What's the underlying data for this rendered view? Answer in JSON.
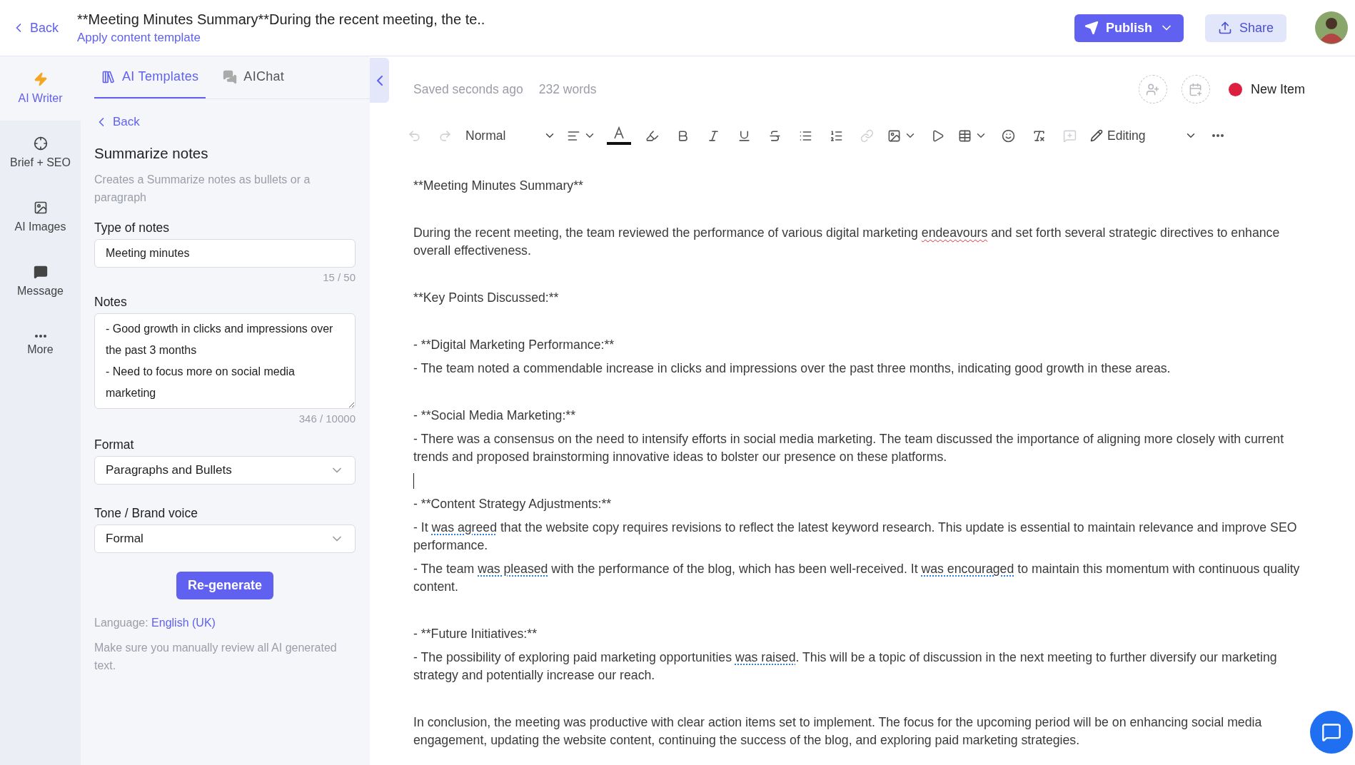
{
  "header": {
    "back": "Back",
    "title": "**Meeting Minutes Summary**During the recent meeting, the te..",
    "template_link": "Apply content template",
    "publish": "Publish",
    "share": "Share"
  },
  "rail": [
    {
      "label": "AI Writer",
      "selected": true
    },
    {
      "label": "Brief + SEO",
      "selected": false
    },
    {
      "label": "AI Images",
      "selected": false
    },
    {
      "label": "Message",
      "selected": false
    },
    {
      "label": "More",
      "selected": false
    }
  ],
  "panel": {
    "tabs": [
      {
        "label": "AI Templates",
        "selected": true
      },
      {
        "label": "AIChat",
        "selected": false
      }
    ],
    "back": "Back",
    "title": "Summarize notes",
    "description": "Creates a Summarize notes as bullets or a paragraph",
    "fields": [
      {
        "kind": "input",
        "label": "Type of notes",
        "value": "Meeting minutes",
        "count": "15 / 50"
      },
      {
        "kind": "textarea",
        "label": "Notes",
        "value": "- Good growth in clicks and impressions over the past 3 months\n- Need to focus more on social media marketing",
        "count": "346 / 10000"
      },
      {
        "kind": "select",
        "label": "Format",
        "value": "Paragraphs and Bullets"
      },
      {
        "kind": "select",
        "label": "Tone / Brand voice",
        "value": "Formal"
      }
    ],
    "button": "Re-generate",
    "language_label": "Language:",
    "language": "English (UK)",
    "disclaimer": "Make sure you manually review all AI generated text."
  },
  "editor": {
    "saved": "Saved seconds ago",
    "words": "232 words",
    "status": {
      "label": "New Item",
      "color": "#dc1f3f"
    },
    "toolbar": [
      {
        "kind": "undo",
        "disabled": true,
        "menu": false
      },
      {
        "kind": "redo",
        "disabled": true,
        "menu": false
      },
      {
        "kind": "select",
        "value": "Normal",
        "disabled": false,
        "menu": true
      },
      {
        "kind": "align",
        "disabled": false,
        "menu": true
      },
      {
        "kind": "text-color",
        "disabled": false,
        "menu": false
      },
      {
        "kind": "highlight",
        "disabled": false,
        "menu": false
      },
      {
        "kind": "bold",
        "disabled": false,
        "menu": false
      },
      {
        "kind": "italic",
        "disabled": false,
        "menu": false
      },
      {
        "kind": "underline",
        "disabled": false,
        "menu": false
      },
      {
        "kind": "strike",
        "disabled": false,
        "menu": false
      },
      {
        "kind": "bullets",
        "disabled": false,
        "menu": false
      },
      {
        "kind": "numbers",
        "disabled": false,
        "menu": false
      },
      {
        "kind": "link",
        "disabled": true,
        "menu": false
      },
      {
        "kind": "image",
        "disabled": false,
        "menu": true
      },
      {
        "kind": "video",
        "disabled": false,
        "menu": false
      },
      {
        "kind": "table",
        "disabled": false,
        "menu": true
      },
      {
        "kind": "emoji",
        "disabled": false,
        "menu": false
      },
      {
        "kind": "clear",
        "disabled": false,
        "menu": false
      },
      {
        "kind": "comment",
        "disabled": true,
        "menu": false
      },
      {
        "kind": "mode",
        "value": "Editing",
        "disabled": false,
        "menu": true
      },
      {
        "kind": "more",
        "disabled": false,
        "menu": false
      }
    ],
    "blocks": [
      {
        "kind": "paragraph",
        "text": "**Meeting Minutes Summary**"
      },
      {
        "kind": "blank"
      },
      {
        "kind": "paragraph",
        "segments": [
          {
            "text": "During the recent meeting, the team reviewed the performance of various digital marketing "
          },
          {
            "text": "endeavours",
            "kind": "spelling"
          },
          {
            "text": " and set forth several strategic directives to enhance overall effectiveness."
          }
        ]
      },
      {
        "kind": "blank"
      },
      {
        "kind": "paragraph",
        "text": "**Key Points Discussed:**"
      },
      {
        "kind": "blank"
      },
      {
        "kind": "paragraph",
        "text": "- **Digital Marketing Performance:**"
      },
      {
        "kind": "paragraph",
        "text": "- The team noted a commendable increase in clicks and impressions over the past three months, indicating good growth in these areas."
      },
      {
        "kind": "blank"
      },
      {
        "kind": "paragraph",
        "text": "- **Social Media Marketing:**"
      },
      {
        "kind": "paragraph",
        "text": "- There was a consensus on the need to intensify efforts in social media marketing. The team discussed the importance of aligning more closely with current trends and proposed brainstorming innovative ideas to bolster our presence on these platforms."
      },
      {
        "kind": "caret"
      },
      {
        "kind": "paragraph",
        "text": "- **Content Strategy Adjustments:**"
      },
      {
        "kind": "paragraph",
        "segments": [
          {
            "text": "- It "
          },
          {
            "text": "was agreed",
            "kind": "grammar"
          },
          {
            "text": " that the website copy requires revisions to reflect the latest keyword research. This update is essential to maintain relevance and improve SEO performance."
          }
        ]
      },
      {
        "kind": "paragraph",
        "segments": [
          {
            "text": "- The team "
          },
          {
            "text": "was pleased",
            "kind": "grammar"
          },
          {
            "text": " with the performance of the blog, which has been well-received. It "
          },
          {
            "text": "was encouraged",
            "kind": "grammar"
          },
          {
            "text": " to maintain this momentum with continuous quality content."
          }
        ]
      },
      {
        "kind": "blank"
      },
      {
        "kind": "paragraph",
        "text": "- **Future Initiatives:**"
      },
      {
        "kind": "paragraph",
        "segments": [
          {
            "text": "- The possibility of exploring paid marketing opportunities "
          },
          {
            "text": "was raised",
            "kind": "grammar"
          },
          {
            "text": ". This will be a topic of discussion in the next meeting to further diversify our marketing strategy and potentially increase our reach."
          }
        ]
      },
      {
        "kind": "blank"
      },
      {
        "kind": "paragraph",
        "text": "In conclusion, the meeting was productive with clear action items set to implement. The focus for the upcoming period will be on enhancing social media engagement, updating the website content, continuing the success of the blog, and exploring paid marketing strategies."
      }
    ]
  }
}
